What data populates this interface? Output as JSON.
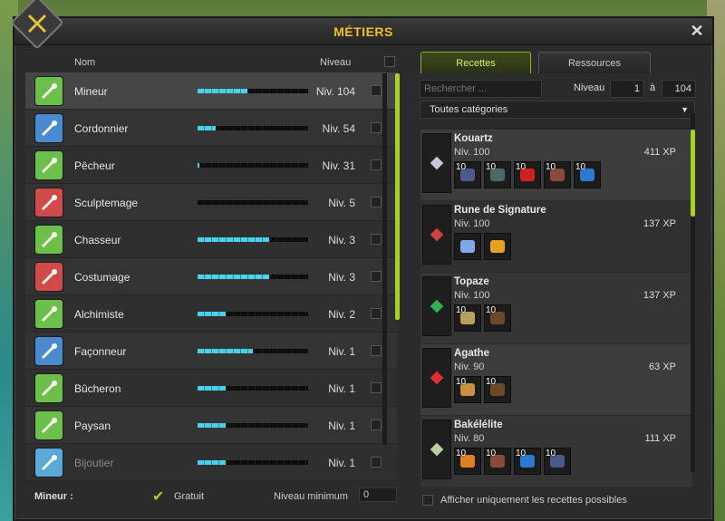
{
  "window": {
    "title": "MÉTIERS",
    "close": "✕"
  },
  "jobs_panel": {
    "header": {
      "name": "Nom",
      "level": "Niveau"
    },
    "jobs": [
      {
        "name": "Mineur",
        "level": "Niv. 104",
        "progress": 0.45,
        "icon": "pickaxe-icon",
        "color": "#6cbf4a",
        "selected": true,
        "dim": false
      },
      {
        "name": "Cordonnier",
        "level": "Niv. 54",
        "progress": 0.16,
        "icon": "boot-icon",
        "color": "#4a8ad0",
        "selected": false,
        "dim": false
      },
      {
        "name": "Pêcheur",
        "level": "Niv. 31",
        "progress": 0.02,
        "icon": "fishing-rod-icon",
        "color": "#6cbf4a",
        "selected": false,
        "dim": false
      },
      {
        "name": "Sculptemage",
        "level": "Niv. 5",
        "progress": 0.0,
        "icon": "sculpt-icon",
        "color": "#d04a4a",
        "selected": false,
        "dim": false
      },
      {
        "name": "Chasseur",
        "level": "Niv. 3",
        "progress": 0.65,
        "icon": "hunter-icon",
        "color": "#6cbf4a",
        "selected": false,
        "dim": false
      },
      {
        "name": "Costumage",
        "level": "Niv. 3",
        "progress": 0.65,
        "icon": "costume-icon",
        "color": "#d04a4a",
        "selected": false,
        "dim": false
      },
      {
        "name": "Alchimiste",
        "level": "Niv. 2",
        "progress": 0.25,
        "icon": "potion-icon",
        "color": "#6cbf4a",
        "selected": false,
        "dim": false
      },
      {
        "name": "Façonneur",
        "level": "Niv. 1",
        "progress": 0.5,
        "icon": "shield-icon",
        "color": "#4a8ad0",
        "selected": false,
        "dim": false
      },
      {
        "name": "Bûcheron",
        "level": "Niv. 1",
        "progress": 0.25,
        "icon": "axe-icon",
        "color": "#6cbf4a",
        "selected": false,
        "dim": false
      },
      {
        "name": "Paysan",
        "level": "Niv. 1",
        "progress": 0.25,
        "icon": "scythe-icon",
        "color": "#6cbf4a",
        "selected": false,
        "dim": false
      },
      {
        "name": "Bijoutier",
        "level": "Niv. 1",
        "progress": 0.25,
        "icon": "gem-icon",
        "color": "#5aa8d8",
        "selected": false,
        "dim": true
      }
    ],
    "footer": {
      "title": "Mineur :",
      "gratuit_label": "Gratuit",
      "min_level_label": "Niveau minimum",
      "min_level_value": "0"
    }
  },
  "recipes_panel": {
    "tabs": [
      {
        "label": "Recettes",
        "active": true
      },
      {
        "label": "Ressources",
        "active": false
      }
    ],
    "search": {
      "placeholder": "Rechercher ...",
      "level_label": "Niveau",
      "level_from": "1",
      "level_sep": "à",
      "level_to": "104"
    },
    "category": "Toutes catégories",
    "recipes": [
      {
        "name": "Kouartz",
        "level": "Niv. 100",
        "xp": "411 XP",
        "icon_color": "#c8c8d8",
        "ingredients": [
          {
            "qty": "10",
            "color": "#4a5a8a"
          },
          {
            "qty": "10",
            "color": "#4a6a6a"
          },
          {
            "qty": "10",
            "color": "#d02020"
          },
          {
            "qty": "10",
            "color": "#8a4a3a"
          },
          {
            "qty": "10",
            "color": "#2a7ad0"
          }
        ]
      },
      {
        "name": "Rune de Signature",
        "level": "Niv. 100",
        "xp": "137 XP",
        "icon_color": "#d04040",
        "ingredients": [
          {
            "qty": "",
            "color": "#80a8e8"
          },
          {
            "qty": "",
            "color": "#e8a020"
          }
        ]
      },
      {
        "name": "Topaze",
        "level": "Niv. 100",
        "xp": "137 XP",
        "icon_color": "#30b050",
        "ingredients": [
          {
            "qty": "10",
            "color": "#b8a060"
          },
          {
            "qty": "10",
            "color": "#6a4a2a"
          }
        ]
      },
      {
        "name": "Agathe",
        "level": "Niv. 90",
        "xp": "63 XP",
        "icon_color": "#e03030",
        "ingredients": [
          {
            "qty": "10",
            "color": "#c89040"
          },
          {
            "qty": "10",
            "color": "#6a4a2a"
          }
        ]
      },
      {
        "name": "Bakélélite",
        "level": "Niv. 80",
        "xp": "111 XP",
        "icon_color": "#b8d0a0",
        "ingredients": [
          {
            "qty": "10",
            "color": "#e08020"
          },
          {
            "qty": "10",
            "color": "#8a4a3a"
          },
          {
            "qty": "10",
            "color": "#2a7ad0"
          },
          {
            "qty": "10",
            "color": "#4a5a8a"
          }
        ]
      }
    ],
    "footer_label": "Afficher uniquement les recettes possibles"
  }
}
